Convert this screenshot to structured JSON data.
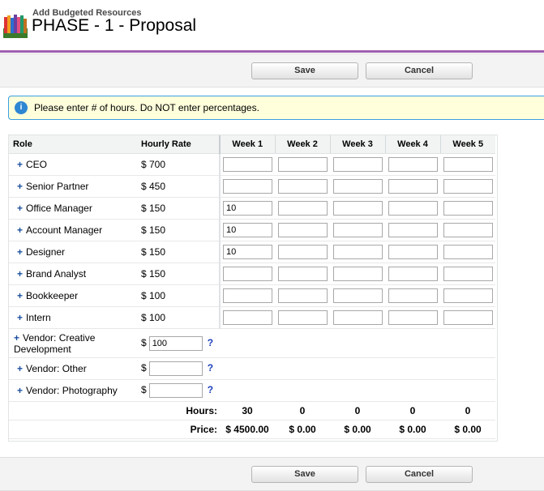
{
  "header": {
    "subtitle": "Add Budgeted Resources",
    "title": "PHASE - 1 - Proposal"
  },
  "buttons": {
    "save": "Save",
    "cancel": "Cancel"
  },
  "info": {
    "icon_text": "i",
    "message": "Please enter # of hours. Do NOT enter percentages."
  },
  "table": {
    "headers": {
      "role": "Role",
      "rate": "Hourly Rate",
      "weeks": [
        "Week 1",
        "Week 2",
        "Week 3",
        "Week 4",
        "Week 5"
      ]
    },
    "rows": [
      {
        "plus": "+",
        "role": "CEO",
        "rate": "$ 700",
        "hours": [
          "",
          "",
          "",
          "",
          ""
        ]
      },
      {
        "plus": "+",
        "role": "Senior Partner",
        "rate": "$ 450",
        "hours": [
          "",
          "",
          "",
          "",
          ""
        ]
      },
      {
        "plus": "+",
        "role": "Office Manager",
        "rate": "$ 150",
        "hours": [
          "10",
          "",
          "",
          "",
          ""
        ]
      },
      {
        "plus": "+",
        "role": "Account Manager",
        "rate": "$ 150",
        "hours": [
          "10",
          "",
          "",
          "",
          ""
        ]
      },
      {
        "plus": "+",
        "role": "Designer",
        "rate": "$ 150",
        "hours": [
          "10",
          "",
          "",
          "",
          ""
        ]
      },
      {
        "plus": "+",
        "role": "Brand Analyst",
        "rate": "$ 150",
        "hours": [
          "",
          "",
          "",
          "",
          ""
        ]
      },
      {
        "plus": "+",
        "role": "Bookkeeper",
        "rate": "$ 100",
        "hours": [
          "",
          "",
          "",
          "",
          ""
        ]
      },
      {
        "plus": "+",
        "role": "Intern",
        "rate": "$ 100",
        "hours": [
          "",
          "",
          "",
          "",
          ""
        ]
      }
    ],
    "vendors": [
      {
        "plus": "+",
        "role": "Vendor: Creative Development",
        "dollar": "$",
        "rate_value": "100",
        "help": "?"
      },
      {
        "plus": "+",
        "role": "Vendor: Other",
        "dollar": "$",
        "rate_value": "",
        "help": "?"
      },
      {
        "plus": "+",
        "role": "Vendor: Photography",
        "dollar": "$",
        "rate_value": "",
        "help": "?"
      }
    ],
    "totals": {
      "hours_label": "Hours:",
      "hours": [
        "30",
        "0",
        "0",
        "0",
        "0"
      ],
      "price_label": "Price:",
      "price": [
        "$ 4500.00",
        "$ 0.00",
        "$ 0.00",
        "$ 0.00",
        "$ 0.00"
      ]
    }
  }
}
